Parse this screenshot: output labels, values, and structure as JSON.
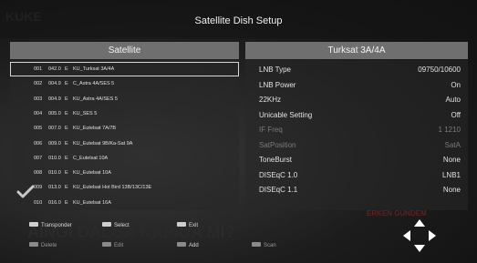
{
  "window_title": "Satellite Dish Setup",
  "background": {
    "deco_top_left": "KUKE",
    "deco_headline": "AINGI DALGA KAPIDA MI?",
    "deco_badge": "ERKEN GUNDEM"
  },
  "left_panel": {
    "header": "Satellite",
    "selected_index": 0,
    "checked_index": 8,
    "rows": [
      {
        "num": "001",
        "pos": "042.0",
        "dir": "E",
        "name": "KU_Turksat 3A/4A"
      },
      {
        "num": "002",
        "pos": "004.9",
        "dir": "E",
        "name": "C_Astra 4A/SES 5"
      },
      {
        "num": "003",
        "pos": "004.9",
        "dir": "E",
        "name": "KU_Astra 4A/SES 5"
      },
      {
        "num": "004",
        "pos": "005.0",
        "dir": "E",
        "name": "KU_SES 5"
      },
      {
        "num": "005",
        "pos": "007.0",
        "dir": "E",
        "name": "KU_Eutelsat 7A/7B"
      },
      {
        "num": "006",
        "pos": "009.0",
        "dir": "E",
        "name": "KU_Eutelsat 9B/Ka-Sat 9A"
      },
      {
        "num": "007",
        "pos": "010.0",
        "dir": "E",
        "name": "C_Eutelsat 10A"
      },
      {
        "num": "008",
        "pos": "010.0",
        "dir": "E",
        "name": "KU_Eutelsat 10A"
      },
      {
        "num": "009",
        "pos": "013.0",
        "dir": "E",
        "name": "KU_Eutelsat Hot Bird 13B/13C/13E"
      },
      {
        "num": "010",
        "pos": "016.0",
        "dir": "E",
        "name": "KU_Eutelsat 16A"
      }
    ]
  },
  "right_panel": {
    "header": "Turksat 3A/4A",
    "rows": [
      {
        "label": "LNB Type",
        "value": "09750/10600",
        "disabled": false
      },
      {
        "label": "LNB Power",
        "value": "On",
        "disabled": false
      },
      {
        "label": "22KHz",
        "value": "Auto",
        "disabled": false
      },
      {
        "label": "Unicable Setting",
        "value": "Off",
        "disabled": false
      },
      {
        "label": "IF Freq",
        "value": "1 1210",
        "disabled": true
      },
      {
        "label": "SatPosition",
        "value": "SatA",
        "disabled": true
      },
      {
        "label": "ToneBurst",
        "value": "None",
        "disabled": false
      },
      {
        "label": "DISEqC 1.0",
        "value": "LNB1",
        "disabled": false
      },
      {
        "label": "DISEqC 1.1",
        "value": "None",
        "disabled": false
      }
    ]
  },
  "footer": {
    "transponder": "Transponder",
    "select": "Select",
    "exit": "Exit",
    "delete": "Delete",
    "edit": "Edit",
    "add": "Add",
    "scan": "Scan"
  },
  "icons": {
    "check": "check-icon",
    "navigation": "dpad-arrows-icon",
    "key_badge": "remote-key-icon"
  },
  "colors": {
    "header_bg": "#6f6f6f",
    "text": "#e6e6e6",
    "disabled_text": "#7a7a7a",
    "nav_icon": "#ffffff"
  }
}
